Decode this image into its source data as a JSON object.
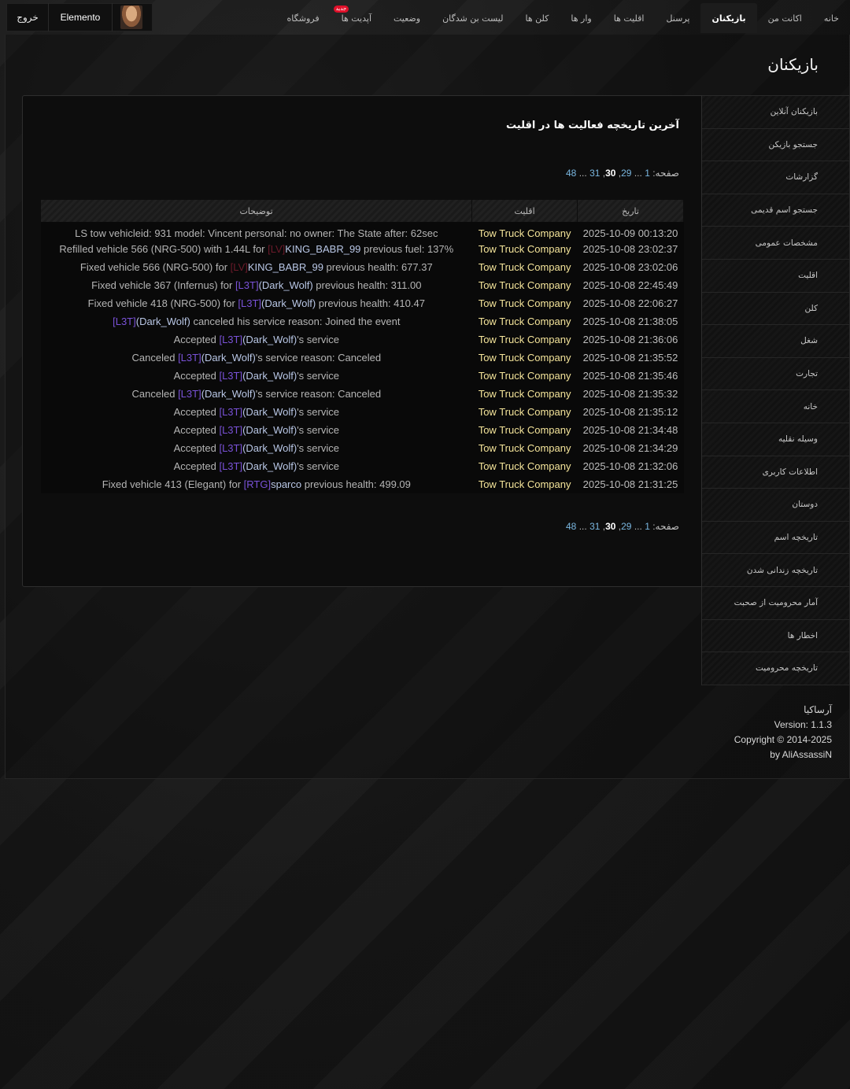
{
  "header": {
    "logout": "خروج",
    "username": "Elemento",
    "nav": [
      {
        "label": "خانه",
        "active": false
      },
      {
        "label": "اکانت من",
        "active": false
      },
      {
        "label": "بازیکنان",
        "active": true
      },
      {
        "label": "پرسنل",
        "active": false
      },
      {
        "label": "اقلیت ها",
        "active": false
      },
      {
        "label": "وار ها",
        "active": false
      },
      {
        "label": "کلن ها",
        "active": false
      },
      {
        "label": "لیست بن شدگان",
        "active": false
      },
      {
        "label": "وضعیت",
        "active": false
      },
      {
        "label": "آپدیت ها",
        "active": false,
        "badge": "جدید"
      },
      {
        "label": "فروشگاه",
        "active": false
      }
    ]
  },
  "page_title": "بازیکنان",
  "sidebar": [
    "بازیکنان آنلاین",
    "جستجو بازیکن",
    "گزارشات",
    "جستجو اسم قدیمی",
    "مشخصات عمومی",
    "اقلیت",
    "کلن",
    "شغل",
    "تجارت",
    "خانه",
    "وسیله نقلیه",
    "اطلاعات کاربری",
    "دوستان",
    "تاریخچه اسم",
    "تاریخچه زندانی شدن",
    "آمار محرومیت از صحبت",
    "اخطار ها",
    "تاریخچه محرومیت"
  ],
  "panel": {
    "title": "آخرین تاریخچه فعالیت ها در اقلیت",
    "pager": {
      "label": "صفحه:",
      "first": "1",
      "dots1": "...",
      "p29": "29",
      "p30": "30",
      "p31": "31",
      "dots2": "...",
      "last": "48"
    },
    "columns": {
      "date": "تاریخ",
      "faction": "اقلیت",
      "desc": "توضیحات"
    }
  },
  "rows": [
    {
      "date": "2025-10-09 00:13:20",
      "faction": "Tow Truck Company",
      "desc": "LS tow vehicleid: 931 model: Vincent personal: no owner: The State after: 62sec"
    },
    {
      "date": "2025-10-08 23:02:37",
      "faction": "Tow Truck Company",
      "pre": "Refilled vehicle 566 (NRG-500) with 1.44L for ",
      "tag": "[LV]",
      "tagType": "lv",
      "name": "KING_BABR_99",
      "post": " previous fuel: 137%"
    },
    {
      "date": "2025-10-08 23:02:06",
      "faction": "Tow Truck Company",
      "pre": "Fixed vehicle 566 (NRG-500) for ",
      "tag": "[LV]",
      "tagType": "lv",
      "name": "KING_BABR_99",
      "post": " previous health: 677.37"
    },
    {
      "date": "2025-10-08 22:45:49",
      "faction": "Tow Truck Company",
      "pre": "Fixed vehicle 367 (Infernus) for ",
      "tag": "[L3T]",
      "name": "(Dark_Wolf)",
      "post": " previous health: 311.00"
    },
    {
      "date": "2025-10-08 22:06:27",
      "faction": "Tow Truck Company",
      "pre": "Fixed vehicle 418 (NRG-500) for ",
      "tag": "[L3T]",
      "name": "(Dark_Wolf)",
      "post": " previous health: 410.47"
    },
    {
      "date": "2025-10-08 21:38:05",
      "faction": "Tow Truck Company",
      "pre": "",
      "tag": "[L3T]",
      "name": "(Dark_Wolf)",
      "post": " canceled his service reason: Joined the event"
    },
    {
      "date": "2025-10-08 21:36:06",
      "faction": "Tow Truck Company",
      "pre": "Accepted ",
      "tag": "[L3T]",
      "name": "(Dark_Wolf)",
      "post": "'s service"
    },
    {
      "date": "2025-10-08 21:35:52",
      "faction": "Tow Truck Company",
      "pre": "Canceled ",
      "tag": "[L3T]",
      "name": "(Dark_Wolf)",
      "post": "'s service reason: Canceled"
    },
    {
      "date": "2025-10-08 21:35:46",
      "faction": "Tow Truck Company",
      "pre": "Accepted ",
      "tag": "[L3T]",
      "name": "(Dark_Wolf)",
      "post": "'s service"
    },
    {
      "date": "2025-10-08 21:35:32",
      "faction": "Tow Truck Company",
      "pre": "Canceled ",
      "tag": "[L3T]",
      "name": "(Dark_Wolf)",
      "post": "'s service reason: Canceled"
    },
    {
      "date": "2025-10-08 21:35:12",
      "faction": "Tow Truck Company",
      "pre": "Accepted ",
      "tag": "[L3T]",
      "name": "(Dark_Wolf)",
      "post": "'s service"
    },
    {
      "date": "2025-10-08 21:34:48",
      "faction": "Tow Truck Company",
      "pre": "Accepted ",
      "tag": "[L3T]",
      "name": "(Dark_Wolf)",
      "post": "'s service"
    },
    {
      "date": "2025-10-08 21:34:29",
      "faction": "Tow Truck Company",
      "pre": "Accepted ",
      "tag": "[L3T]",
      "name": "(Dark_Wolf)",
      "post": "'s service"
    },
    {
      "date": "2025-10-08 21:32:06",
      "faction": "Tow Truck Company",
      "pre": "Accepted ",
      "tag": "[L3T]",
      "name": "(Dark_Wolf)",
      "post": "'s service"
    },
    {
      "date": "2025-10-08 21:31:25",
      "faction": "Tow Truck Company",
      "pre": "Fixed vehicle 413 (Elegant) for ",
      "tag": "[RTG]",
      "name": "sparco",
      "post": " previous health: 499.09"
    }
  ],
  "footer": {
    "site": "آرساکیا",
    "version": "Version: 1.1.3",
    "copyright": "Copyright © 2014-2025",
    "author": "by AliAssassiN"
  }
}
